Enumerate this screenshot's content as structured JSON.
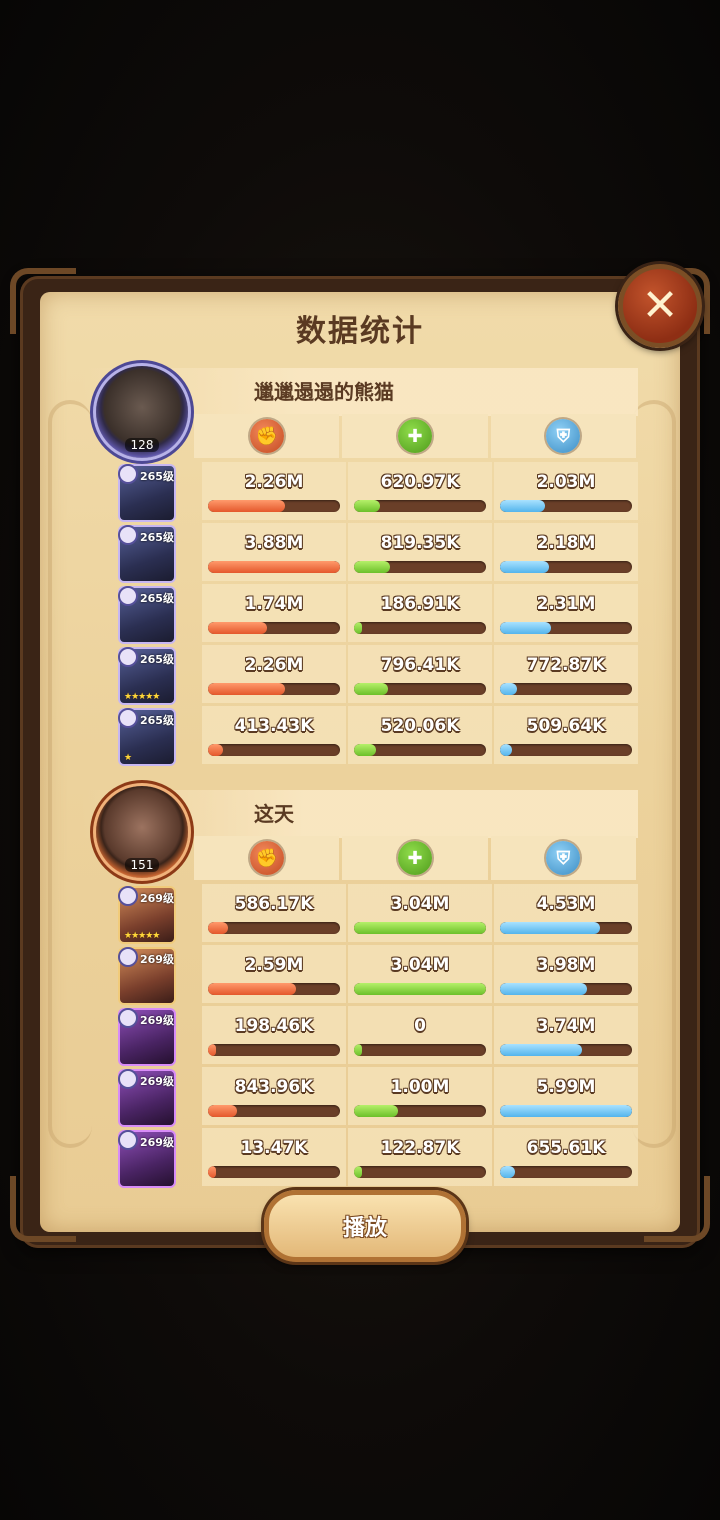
{
  "title": "数据统计",
  "close_label": "✕",
  "replay_label": "播放",
  "stat_icons": {
    "damage": "damage-icon",
    "heal": "heal-icon",
    "defense": "shield-icon"
  },
  "colors": {
    "damage": "#e4582c",
    "heal": "#6cc02a",
    "defense": "#53b4ec"
  },
  "teams": [
    {
      "player_name": "邋邋遢遢的熊猫",
      "player_level": "128",
      "heroes": [
        {
          "level": "265级",
          "stars": "",
          "damage": "2.26M",
          "heal": "620.97K",
          "defense": "2.03M",
          "damage_pct": 0.58,
          "heal_pct": 0.2,
          "defense_pct": 0.34
        },
        {
          "level": "265级",
          "stars": "",
          "damage": "3.88M",
          "heal": "819.35K",
          "defense": "2.18M",
          "damage_pct": 1.0,
          "heal_pct": 0.27,
          "defense_pct": 0.37
        },
        {
          "level": "265级",
          "stars": "",
          "damage": "1.74M",
          "heal": "186.91K",
          "defense": "2.31M",
          "damage_pct": 0.45,
          "heal_pct": 0.06,
          "defense_pct": 0.39
        },
        {
          "level": "265级",
          "stars": "★★★★★",
          "damage": "2.26M",
          "heal": "796.41K",
          "defense": "772.87K",
          "damage_pct": 0.58,
          "heal_pct": 0.26,
          "defense_pct": 0.13
        },
        {
          "level": "265级",
          "stars": "★",
          "damage": "413.43K",
          "heal": "520.06K",
          "defense": "509.64K",
          "damage_pct": 0.11,
          "heal_pct": 0.17,
          "defense_pct": 0.09
        }
      ]
    },
    {
      "player_name": "这天",
      "player_level": "151",
      "heroes": [
        {
          "level": "269级",
          "stars": "★★★★★",
          "damage": "586.17K",
          "heal": "3.04M",
          "defense": "4.53M",
          "damage_pct": 0.15,
          "heal_pct": 1.0,
          "defense_pct": 0.76
        },
        {
          "level": "269级",
          "stars": "",
          "damage": "2.59M",
          "heal": "3.04M",
          "defense": "3.98M",
          "damage_pct": 0.67,
          "heal_pct": 1.0,
          "defense_pct": 0.66
        },
        {
          "level": "269级",
          "stars": "",
          "damage": "198.46K",
          "heal": "0",
          "defense": "3.74M",
          "damage_pct": 0.05,
          "heal_pct": 0.0,
          "defense_pct": 0.62
        },
        {
          "level": "269级",
          "stars": "",
          "damage": "843.96K",
          "heal": "1.00M",
          "defense": "5.99M",
          "damage_pct": 0.22,
          "heal_pct": 0.33,
          "defense_pct": 1.0
        },
        {
          "level": "269级",
          "stars": "",
          "damage": "13.47K",
          "heal": "122.87K",
          "defense": "655.61K",
          "damage_pct": 0.0,
          "heal_pct": 0.04,
          "defense_pct": 0.11
        }
      ]
    }
  ]
}
